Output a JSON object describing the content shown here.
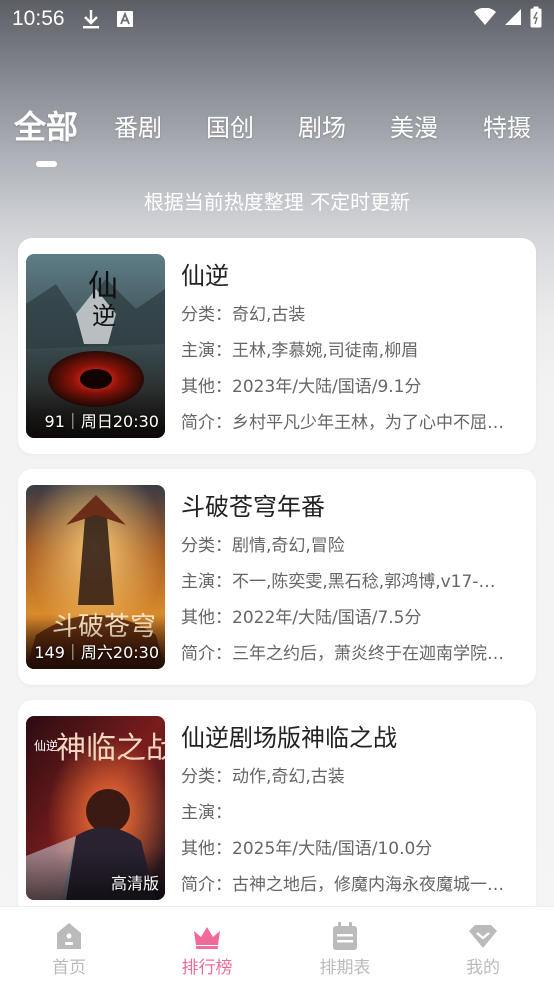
{
  "status_bar": {
    "time": "10:56",
    "icons": [
      "download-icon",
      "a-icon",
      "wifi-icon",
      "signal-icon",
      "battery-icon"
    ]
  },
  "tabs": [
    {
      "label": "全部",
      "active": true
    },
    {
      "label": "番剧"
    },
    {
      "label": "国创"
    },
    {
      "label": "剧场"
    },
    {
      "label": "美漫"
    },
    {
      "label": "特摄"
    }
  ],
  "subtitle": "根据当前热度整理 不定时更新",
  "items": [
    {
      "title": "仙逆",
      "badge": "91｜周日20:30",
      "category": "分类：奇幻,古装",
      "cast": "主演：王林,李慕婉,司徒南,柳眉",
      "other": "其他：2023年/大陆/国语/9.1分",
      "intro": "简介：乡村平凡少年王林，为了心中不屈…"
    },
    {
      "title": "斗破苍穹年番",
      "badge": "149｜周六20:30",
      "category": "分类：剧情,奇幻,冒险",
      "cast": "主演：不一,陈奕雯,黑石稔,郭鸿博,v17-…",
      "other": "其他：2022年/大陆/国语/7.5分",
      "intro": "简介：三年之约后，萧炎终于在迦南学院…"
    },
    {
      "title": "仙逆剧场版神临之战",
      "badge": "高清版",
      "category": "分类：动作,奇幻,古装",
      "cast": "主演：",
      "other": "其他：2025年/大陆/国语/10.0分",
      "intro": "简介：古神之地后，修魔内海永夜魔城一…"
    }
  ],
  "bottom_nav": [
    {
      "label": "首页",
      "icon": "home-icon"
    },
    {
      "label": "排行榜",
      "icon": "crown-icon",
      "active": true
    },
    {
      "label": "排期表",
      "icon": "calendar-icon"
    },
    {
      "label": "我的",
      "icon": "heart-icon"
    }
  ],
  "colors": {
    "accent": "#f06b9a",
    "inactive": "#bbbbbb"
  }
}
